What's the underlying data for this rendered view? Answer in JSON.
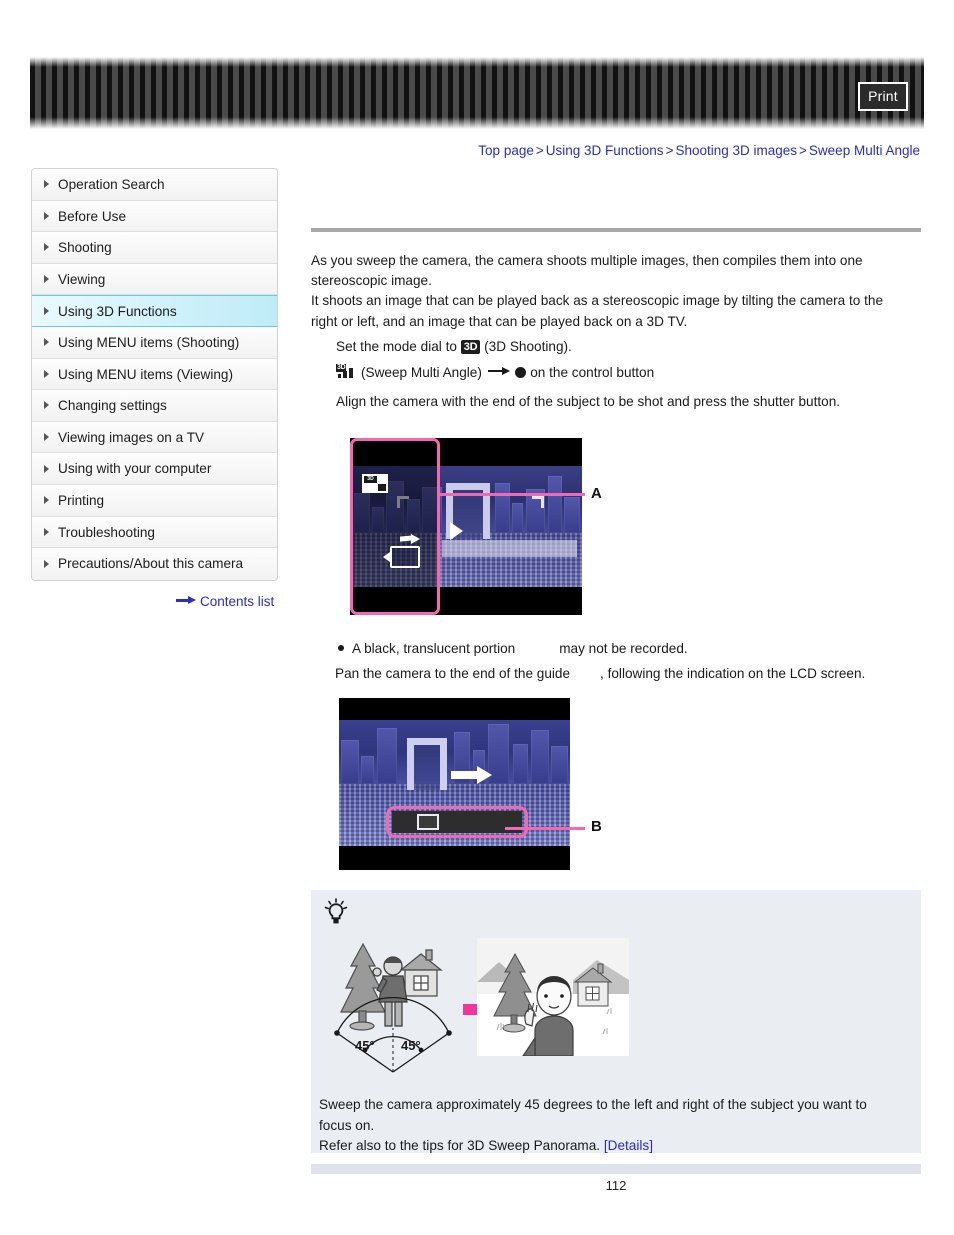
{
  "header": {
    "print_label": "Print"
  },
  "breadcrumb": {
    "items": [
      "Top page",
      "Using 3D Functions",
      "Shooting 3D images",
      "Sweep Multi Angle"
    ],
    "separator": ">"
  },
  "sidebar": {
    "items": [
      {
        "label": "Operation Search",
        "active": false
      },
      {
        "label": "Before Use",
        "active": false
      },
      {
        "label": "Shooting",
        "active": false
      },
      {
        "label": "Viewing",
        "active": false
      },
      {
        "label": "Using 3D Functions",
        "active": true
      },
      {
        "label": "Using MENU items (Shooting)",
        "active": false
      },
      {
        "label": "Using MENU items (Viewing)",
        "active": false
      },
      {
        "label": "Changing settings",
        "active": false
      },
      {
        "label": "Viewing images on a TV",
        "active": false
      },
      {
        "label": "Using with your computer",
        "active": false
      },
      {
        "label": "Printing",
        "active": false
      },
      {
        "label": "Troubleshooting",
        "active": false
      },
      {
        "label": "Precautions/About this camera",
        "active": false
      }
    ],
    "contents_list_label": "Contents list"
  },
  "main": {
    "intro_line1": "As you sweep the camera, the camera shoots multiple images, then compiles them into one",
    "intro_line2": "stereoscopic image.",
    "intro_line3": "It shoots an image that can be played back as a stereoscopic image by tilting the camera to the",
    "intro_line4": "right or left, and an image that can be played back on a 3D TV.",
    "step1_before": "Set the mode dial to",
    "step1_badge": "3D",
    "step1_after": "(3D Shooting).",
    "step2_label": "(Sweep Multi Angle)",
    "step2_after": "on the control button",
    "step3": "Align the camera with the end of the subject to be shot and press the shutter button.",
    "note_bullet_a": "A black, translucent portion",
    "note_bullet_b": "may not be recorded.",
    "note2_a": "Pan the camera to the end of the guide",
    "note2_b": ", following the indication on the LCD screen.",
    "callout_a": "A",
    "callout_b": "B"
  },
  "tip": {
    "angle_left": "45°",
    "angle_right": "45°",
    "line1": "Sweep the camera approximately 45 degrees to the left and right of the subject you want to",
    "line2": "focus on.",
    "line3_text": "Refer also to the tips for 3D Sweep Panorama.",
    "details_link": "[Details]"
  },
  "footer": {
    "page_number": "112"
  },
  "colors": {
    "link": "#2b2bc8",
    "accent_pink": "#f368b3",
    "sidebar_active": "#cdf0fa",
    "tip_bg": "#eaeef3"
  }
}
